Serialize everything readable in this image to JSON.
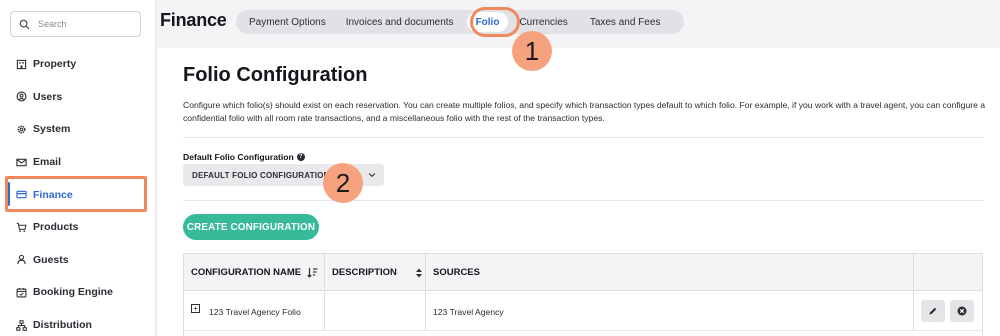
{
  "search": {
    "placeholder": "Search"
  },
  "sidebar": {
    "items": [
      {
        "label": "Property",
        "icon": "building-icon"
      },
      {
        "label": "Users",
        "icon": "user-circle-icon"
      },
      {
        "label": "System",
        "icon": "gear-icon"
      },
      {
        "label": "Email",
        "icon": "envelope-icon"
      },
      {
        "label": "Finance",
        "icon": "credit-card-icon",
        "active": true
      },
      {
        "label": "Products",
        "icon": "cart-icon"
      },
      {
        "label": "Guests",
        "icon": "person-icon"
      },
      {
        "label": "Booking Engine",
        "icon": "calendar-icon"
      },
      {
        "label": "Distribution",
        "icon": "network-icon"
      }
    ]
  },
  "header": {
    "title": "Finance",
    "tabs": [
      {
        "label": "Payment Options"
      },
      {
        "label": "Invoices and documents"
      },
      {
        "label": "Folio",
        "active": true
      },
      {
        "label": "Currencies"
      },
      {
        "label": "Taxes and Fees"
      }
    ]
  },
  "main": {
    "title": "Folio Configuration",
    "description": "Configure which folio(s) should exist on each reservation. You can create multiple folios, and specify which transaction types default to which folio. For example, if you work with a travel agent, you can configure a confidential folio with all room rate transactions, and a miscellaneous folio with the rest of the transaction types.",
    "default_label": "Default Folio Configuration",
    "default_value": "DEFAULT FOLIO CONFIGURATION",
    "create_button": "CREATE CONFIGURATION"
  },
  "table": {
    "headers": {
      "name": "CONFIGURATION NAME",
      "description": "DESCRIPTION",
      "sources": "SOURCES"
    },
    "rows": [
      {
        "name": "123 Travel Agency Folio",
        "description": "",
        "sources": "123 Travel Agency"
      }
    ]
  },
  "annotations": {
    "step1": "1",
    "step2": "2"
  },
  "colors": {
    "accent": "#2f66d6",
    "highlight": "#f08a5d",
    "badge": "#f6a27f",
    "create_button": "#37b99a"
  }
}
